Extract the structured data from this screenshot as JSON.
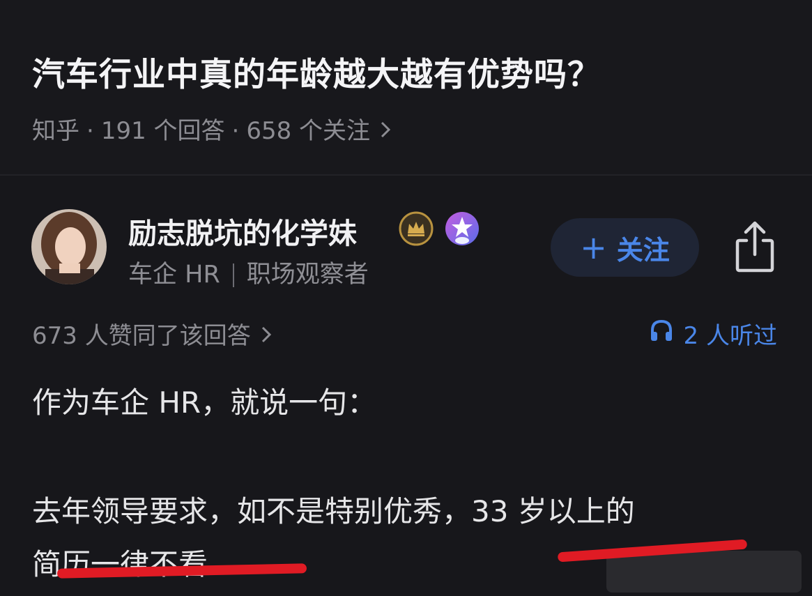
{
  "question": {
    "title": "汽车行业中真的年龄越大越有优势吗？",
    "source": "知乎",
    "answers_count": "191 个回答",
    "followers_count": "658 个关注"
  },
  "author": {
    "name": "励志脱坑的化学妹",
    "title": "车企 HR",
    "role": "职场观察者",
    "follow_label": "关注"
  },
  "stats": {
    "upvotes": "673 人赞同了该回答",
    "listened": "2 人听过"
  },
  "answer": {
    "para1": "作为车企 HR，就说一句：",
    "para2_line1": "去年领导要求，如不是特别优秀，33 岁以上的",
    "para2_line2": "简历一律不看"
  },
  "colors": {
    "background": "#17171b",
    "accent": "#4a86e8",
    "underline": "#e01b24",
    "muted_text": "#8d8d93"
  },
  "icons": {
    "badge1": "crown-badge-icon",
    "badge2": "star-badge-icon",
    "share": "share-icon",
    "headphones": "headphones-icon",
    "chevron": "chevron-right-icon"
  }
}
